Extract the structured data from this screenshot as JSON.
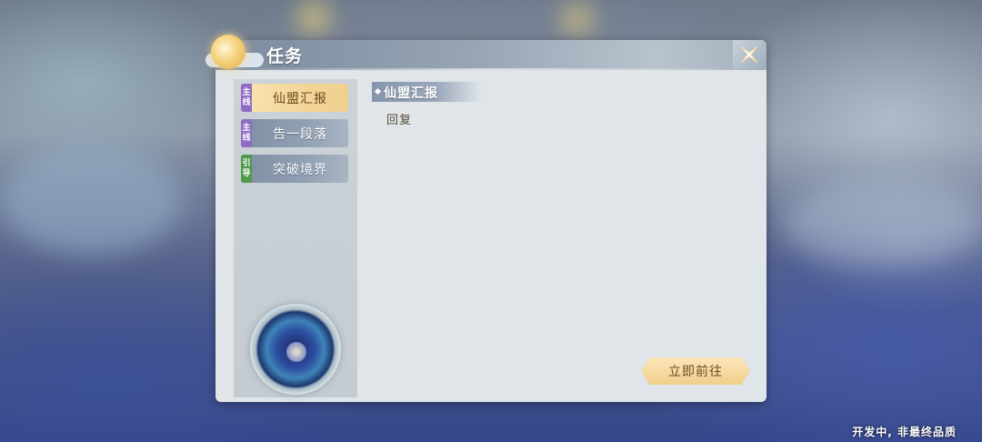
{
  "panel": {
    "title": "任务",
    "close_icon": "close-x-icon"
  },
  "tasks": [
    {
      "tag_top": "主",
      "tag_bottom": "线",
      "tag_type": "main",
      "label": "仙盟汇报",
      "active": true
    },
    {
      "tag_top": "主",
      "tag_bottom": "线",
      "tag_type": "main",
      "label": "告一段落",
      "active": false
    },
    {
      "tag_top": "引",
      "tag_bottom": "导",
      "tag_type": "guide",
      "label": "突破境界",
      "active": false
    }
  ],
  "detail": {
    "title": "仙盟汇报",
    "description": "回复"
  },
  "actions": {
    "go_label": "立即前往"
  },
  "footer": {
    "watermark": "开发中, 非最终品质"
  },
  "colors": {
    "tag_main": "#8f6cc4",
    "tag_guide": "#4f9a4a",
    "active_item": "#f4d597",
    "button_gold": "#f1cf8c"
  }
}
